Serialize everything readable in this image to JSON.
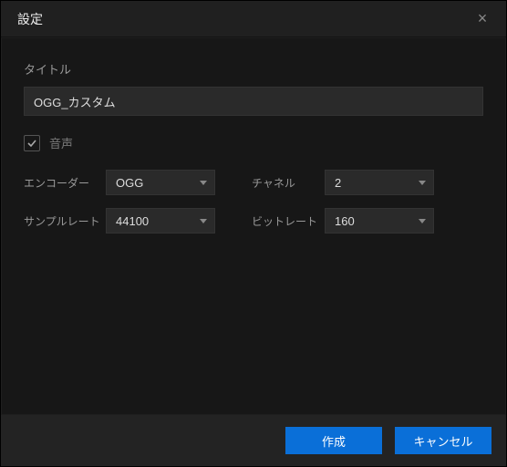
{
  "dialog": {
    "title": "設定",
    "close_icon": "×"
  },
  "form": {
    "title_label": "タイトル",
    "title_value": "OGG_カスタム",
    "audio_checkbox_label": "音声",
    "audio_checked": true,
    "encoder_label": "エンコーダー",
    "encoder_value": "OGG",
    "channel_label": "チャネル",
    "channel_value": "2",
    "samplerate_label": "サンプルレート",
    "samplerate_value": "44100",
    "bitrate_label": "ビットレート",
    "bitrate_value": "160"
  },
  "footer": {
    "create_label": "作成",
    "cancel_label": "キャンセル"
  }
}
